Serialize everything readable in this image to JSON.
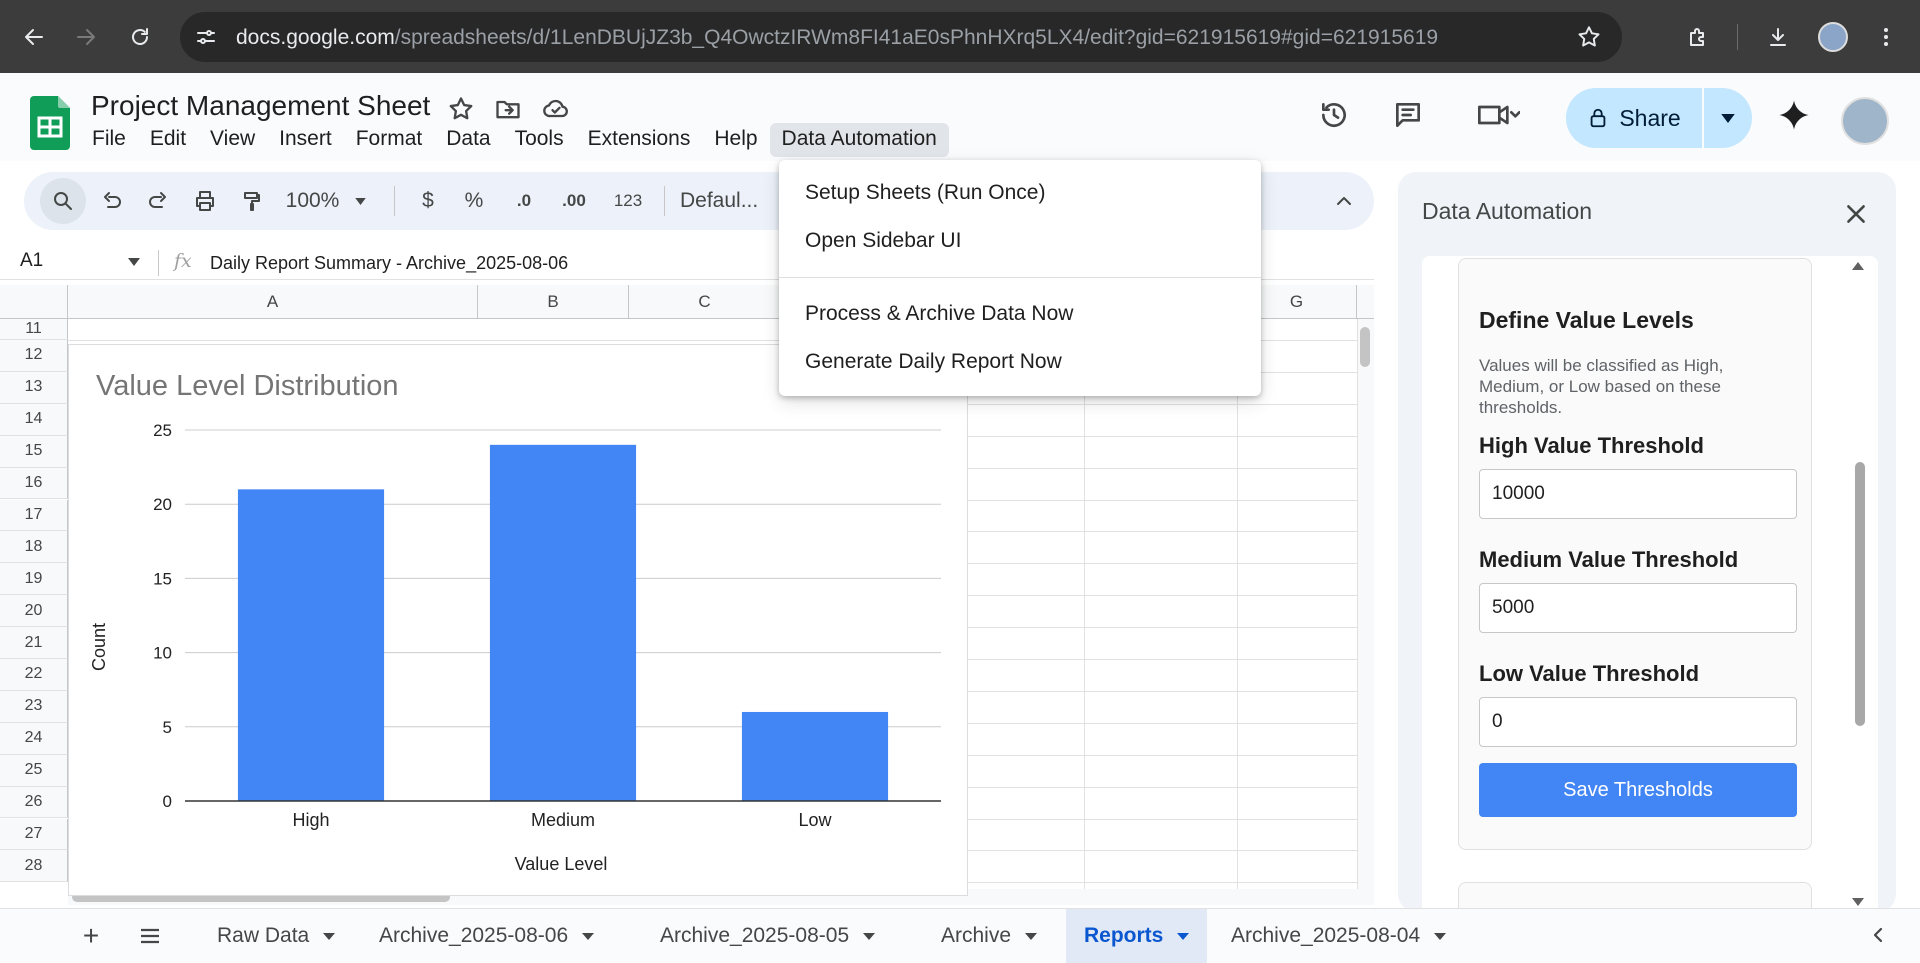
{
  "browser": {
    "url_host": "docs.google.com",
    "url_path": "/spreadsheets/d/1LenDBUjJZ3b_Q4OwctzIRWm8FI41aE0sPhnHXrq5LX4/edit?gid=621915619#gid=621915619"
  },
  "doc": {
    "title": "Project Management Sheet",
    "menus": [
      "File",
      "Edit",
      "View",
      "Insert",
      "Format",
      "Data",
      "Tools",
      "Extensions",
      "Help",
      "Data Automation"
    ],
    "share_label": "Share"
  },
  "toolbar": {
    "zoom": "100%",
    "currency": "$",
    "percent": "%",
    "decrease_decimal": ".0",
    "increase_decimal": ".00",
    "number_format": "123",
    "font": "Defaul..."
  },
  "formula_bar": {
    "cell_ref": "A1",
    "fx": "fx",
    "content": "Daily Report Summary - Archive_2025-08-06"
  },
  "grid": {
    "columns": [
      "A",
      "B",
      "C",
      "G"
    ],
    "rows": [
      "11",
      "12",
      "13",
      "14",
      "15",
      "16",
      "17",
      "18",
      "19",
      "20",
      "21",
      "22",
      "23",
      "24",
      "25",
      "26",
      "27",
      "28"
    ]
  },
  "dropdown": {
    "items": [
      "Setup Sheets (Run Once)",
      "Open Sidebar UI",
      "Process & Archive Data Now",
      "Generate Daily Report Now"
    ]
  },
  "chart_data": {
    "type": "bar",
    "title": "Value Level Distribution",
    "categories": [
      "High",
      "Medium",
      "Low"
    ],
    "values": [
      21,
      24,
      6
    ],
    "xlabel": "Value Level",
    "ylabel": "Count",
    "ylim": [
      0,
      25
    ],
    "yticks": [
      "0",
      "5",
      "10",
      "15",
      "20",
      "25"
    ],
    "bar_color": "#4285f4",
    "grid": true,
    "legend": "none"
  },
  "sidebar": {
    "title": "Data Automation",
    "section_title": "Define Value Levels",
    "description": "Values will be classified as High, Medium, or Low based on these thresholds.",
    "high_label": "High Value Threshold",
    "high_value": "10000",
    "medium_label": "Medium Value Threshold",
    "medium_value": "5000",
    "low_label": "Low Value Threshold",
    "low_value": "0",
    "save_label": "Save Thresholds"
  },
  "sheets": {
    "tabs": [
      "Raw Data",
      "Archive_2025-08-06",
      "Archive_2025-08-05",
      "Archive",
      "Reports",
      "Archive_2025-08-04"
    ],
    "active": "Reports"
  },
  "colors": {
    "accent": "#0b57d0",
    "share_bg": "#c2e7ff",
    "sheets_green": "#0f9d58",
    "button_blue": "#4285f4"
  }
}
